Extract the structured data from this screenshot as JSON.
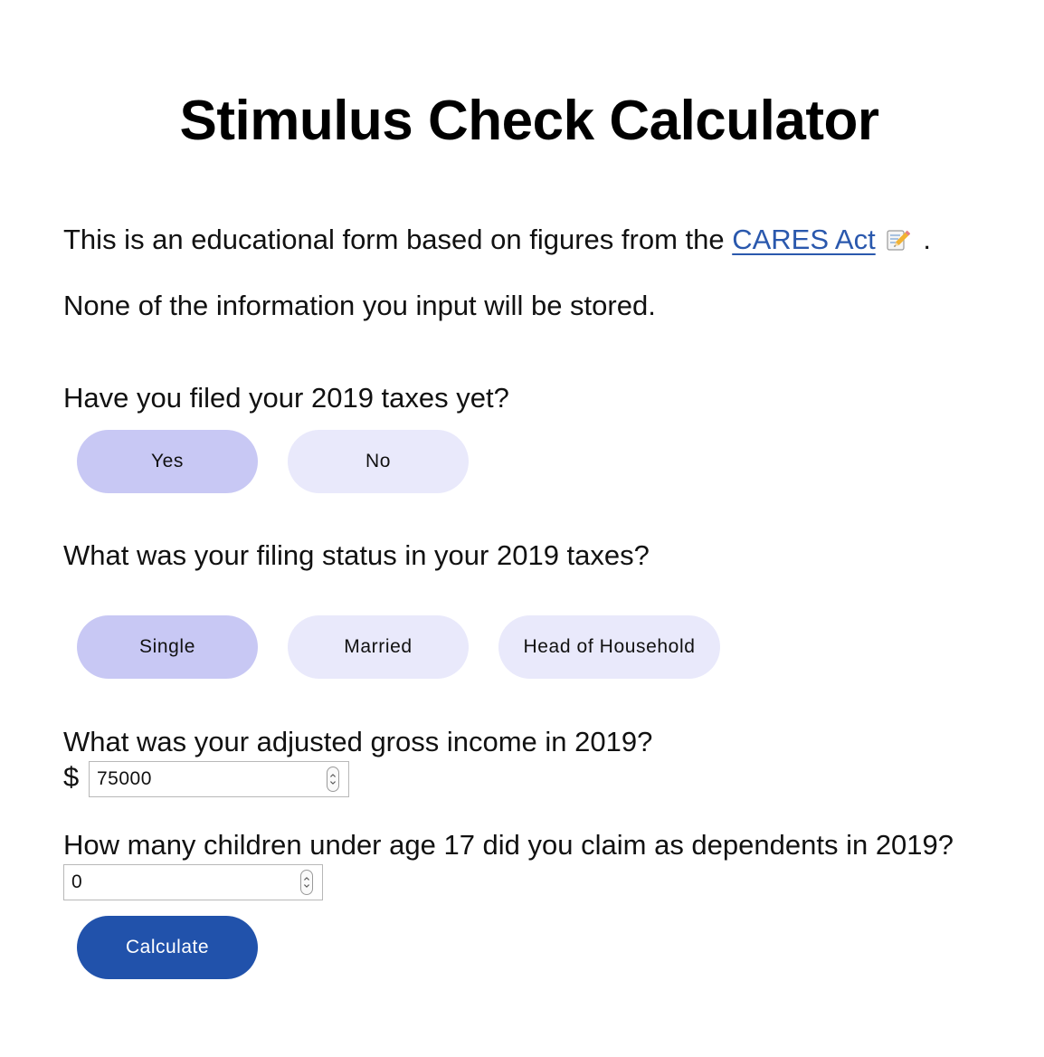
{
  "page": {
    "title": "Stimulus Check Calculator",
    "intro_before_link": "This is an educational form based on figures from the ",
    "intro_link": "CARES Act",
    "intro_after": " .",
    "privacy_note": "None of the information you input will be stored."
  },
  "filed_question": {
    "label": "Have you filed your 2019 taxes yet?",
    "options": [
      "Yes",
      "No"
    ],
    "selected": "Yes"
  },
  "filing_status": {
    "label": "What was your filing status in your 2019 taxes?",
    "options": [
      "Single",
      "Married",
      "Head of Household"
    ],
    "selected": "Single"
  },
  "income": {
    "label": "What was your adjusted gross income in 2019?",
    "currency_symbol": "$",
    "value": "75000"
  },
  "children": {
    "label": "How many children under age 17 did you claim as dependents in 2019?",
    "value": "0"
  },
  "submit_label": "Calculate",
  "colors": {
    "selected_option": "#c8c8f4",
    "unselected_option": "#e9e9fb",
    "primary_button": "#2152ab",
    "link": "#2a58ad"
  },
  "icons": {
    "link_icon": "memo-pencil-icon"
  }
}
